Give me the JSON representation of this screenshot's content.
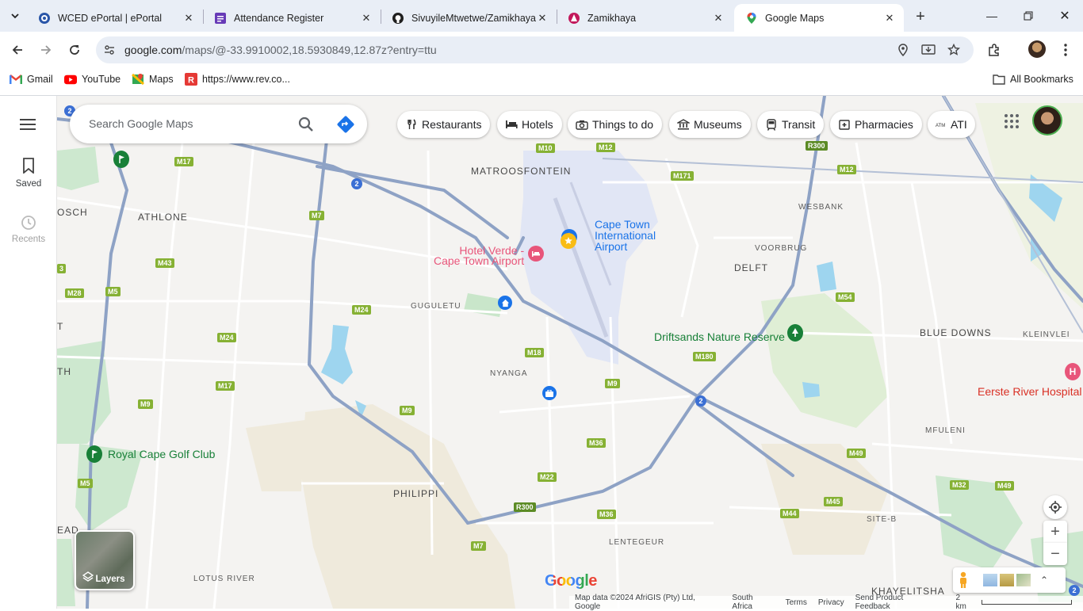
{
  "browser": {
    "tabs": [
      {
        "title": "WCED ePortal | ePortal",
        "icon": "wced-icon"
      },
      {
        "title": "Attendance Register",
        "icon": "forms-icon"
      },
      {
        "title": "SivuyileMtwetwe/Zamikhaya",
        "icon": "github-icon"
      },
      {
        "title": "Zamikhaya",
        "icon": "app-icon"
      },
      {
        "title": "Google Maps",
        "icon": "maps-pin-icon"
      }
    ],
    "url_host": "google.com",
    "url_path": "/maps/@-33.9910002,18.5930849,12.87z?entry=ttu",
    "bookmarks": [
      "Gmail",
      "YouTube",
      "Maps",
      "https://www.rev.co..."
    ],
    "all_bookmarks_label": "All Bookmarks"
  },
  "maps": {
    "search_placeholder": "Search Google Maps",
    "rail": {
      "saved_label": "Saved",
      "recents_label": "Recents"
    },
    "chips": [
      "Restaurants",
      "Hotels",
      "Things to do",
      "Museums",
      "Transit",
      "Pharmacies",
      "ATI"
    ],
    "areas": {
      "matroosfontein": "MATROOSFONTEIN",
      "athlone": "ATHLONE",
      "bosch": "OSCH",
      "wesbank": "WESBANK",
      "voorbrug": "VOORBRUG",
      "delft": "DELFT",
      "gugulethu": "GUGULETU",
      "nyanga": "NYANGA",
      "blue_downs": "BLUE DOWNS",
      "kleinvlei": "KLEINVLEI",
      "mfuleni": "MFULENI",
      "philippi": "PHILIPPI",
      "site_b": "SITE-B",
      "lentegeur": "LENTEGEUR",
      "khayelitsha": "KHAYELITSHA",
      "lotus_river": "LOTUS RIVER",
      "edge_t": "T",
      "edge_th": "TH",
      "edge_ead": "EAD"
    },
    "pois": {
      "airport": "Cape Town International Airport",
      "airport_l1": "Cape Town",
      "airport_l2": "International",
      "airport_l3": "Airport",
      "hotel_l1": "Hotel Verde -",
      "hotel_l2": "Cape Town Airport",
      "driftsands": "Driftsands Nature Reserve",
      "golf": "Royal Cape Golf Club",
      "hospital": "Eerste River Hospital"
    },
    "routes": {
      "m10": "M10",
      "m12a": "M12",
      "m12b": "M12",
      "m171": "M171",
      "m17a": "M17",
      "m17b": "M17",
      "m7a": "M7",
      "m7b": "M7",
      "m43": "M43",
      "m5a": "M5",
      "m5b": "M5",
      "m28": "M28",
      "m24a": "M24",
      "m24b": "M24",
      "m18": "M18",
      "m180": "M180",
      "m9a": "M9",
      "m9b": "M9",
      "m9c": "M9",
      "m36a": "M36",
      "m36b": "M36",
      "m22": "M22",
      "r300a": "R300",
      "r300b": "R300",
      "m54": "M54",
      "m49a": "M49",
      "m49b": "M49",
      "m32": "M32",
      "m45": "M45",
      "m44": "M44",
      "n2a": "2",
      "n2b": "2",
      "n2c": "2",
      "n2d": "2",
      "m3": "3"
    },
    "layers_label": "Layers",
    "google_logo": "Google",
    "footer": {
      "attribution": "Map data ©2024 AfriGIS (Pty) Ltd, Google",
      "region": "South Africa",
      "terms": "Terms",
      "privacy": "Privacy",
      "feedback": "Send Product Feedback",
      "scale": "2 km"
    }
  }
}
